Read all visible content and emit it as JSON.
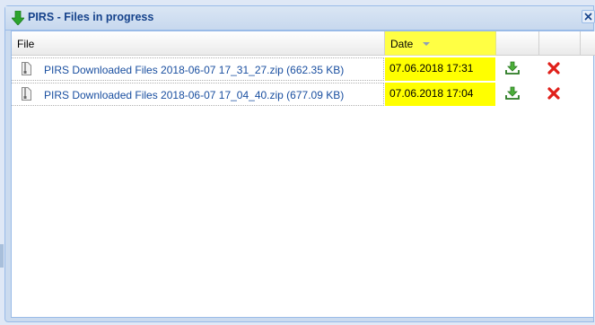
{
  "window": {
    "title": "PIRS - Files in progress"
  },
  "grid": {
    "columns": {
      "file": "File",
      "date": "Date"
    },
    "rows": [
      {
        "file": "PIRS Downloaded Files 2018-06-07 17_31_27.zip (662.35 KB)",
        "date": "07.06.2018 17:31"
      },
      {
        "file": "PIRS Downloaded Files 2018-06-07 17_04_40.zip (677.09 KB)",
        "date": "07.06.2018 17:04"
      }
    ]
  },
  "colors": {
    "title": "#15428b",
    "link": "#1a4fa0",
    "highlight": "#ffff00",
    "download": "#3a9a3a",
    "delete": "#e0201a"
  },
  "icons": {
    "title": "green-down-arrow-icon",
    "file": "zip-file-icon",
    "download": "download-icon",
    "delete": "delete-x-icon",
    "close": "close-icon"
  }
}
